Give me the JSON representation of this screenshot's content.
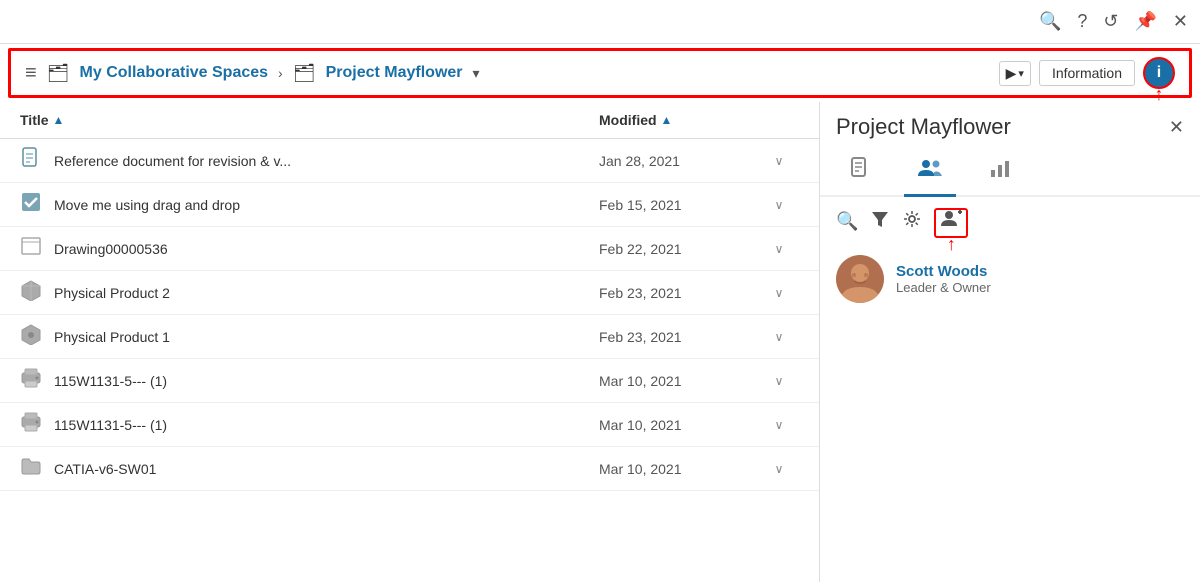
{
  "toolbar": {
    "search_icon": "🔍",
    "question_icon": "?",
    "refresh_icon": "↺",
    "pin_icon": "📌",
    "close_icon": "✕"
  },
  "navbar": {
    "hamburger": "≡",
    "breadcrumb_home": "My Collaborative Spaces",
    "breadcrumb_separator": "›",
    "breadcrumb_current": "Project Mayflower",
    "cursor_label": "▶✓",
    "info_label": "Information",
    "info_icon_label": "i"
  },
  "file_list": {
    "col_title": "Title",
    "col_modified": "Modified",
    "sort_indicator": "▲",
    "rows": [
      {
        "icon": "📄",
        "name": "Reference document for revision & v...",
        "date": "Jan 28, 2021"
      },
      {
        "icon": "✅",
        "name": "Move me using drag and drop",
        "date": "Feb 15, 2021"
      },
      {
        "icon": "",
        "name": "Drawing00000536",
        "date": "Feb 22, 2021"
      },
      {
        "icon": "📦",
        "name": "Physical Product 2",
        "date": "Feb 23, 2021"
      },
      {
        "icon": "🔧",
        "name": "Physical Product 1",
        "date": "Feb 23, 2021"
      },
      {
        "icon": "🖨",
        "name": "115W1131-5--- (1)",
        "date": "Mar 10, 2021"
      },
      {
        "icon": "🖨",
        "name": "115W1131-5--- (1)",
        "date": "Mar 10, 2021"
      },
      {
        "icon": "📁",
        "name": "CATIA-v6-SW01",
        "date": "Mar 10, 2021"
      }
    ]
  },
  "info_panel": {
    "title": "Project Mayflower",
    "close_icon": "✕",
    "tabs": [
      {
        "id": "doc",
        "label": "📄",
        "active": false
      },
      {
        "id": "members",
        "label": "👥",
        "active": true
      },
      {
        "id": "chart",
        "label": "📊",
        "active": false
      }
    ],
    "search_icon": "🔍",
    "filter_icon": "⛁",
    "settings_icon": "⚙",
    "add_member_icon": "👤+",
    "member": {
      "name": "Scott Woods",
      "role": "Leader & Owner",
      "avatar_emoji": "👤"
    }
  }
}
